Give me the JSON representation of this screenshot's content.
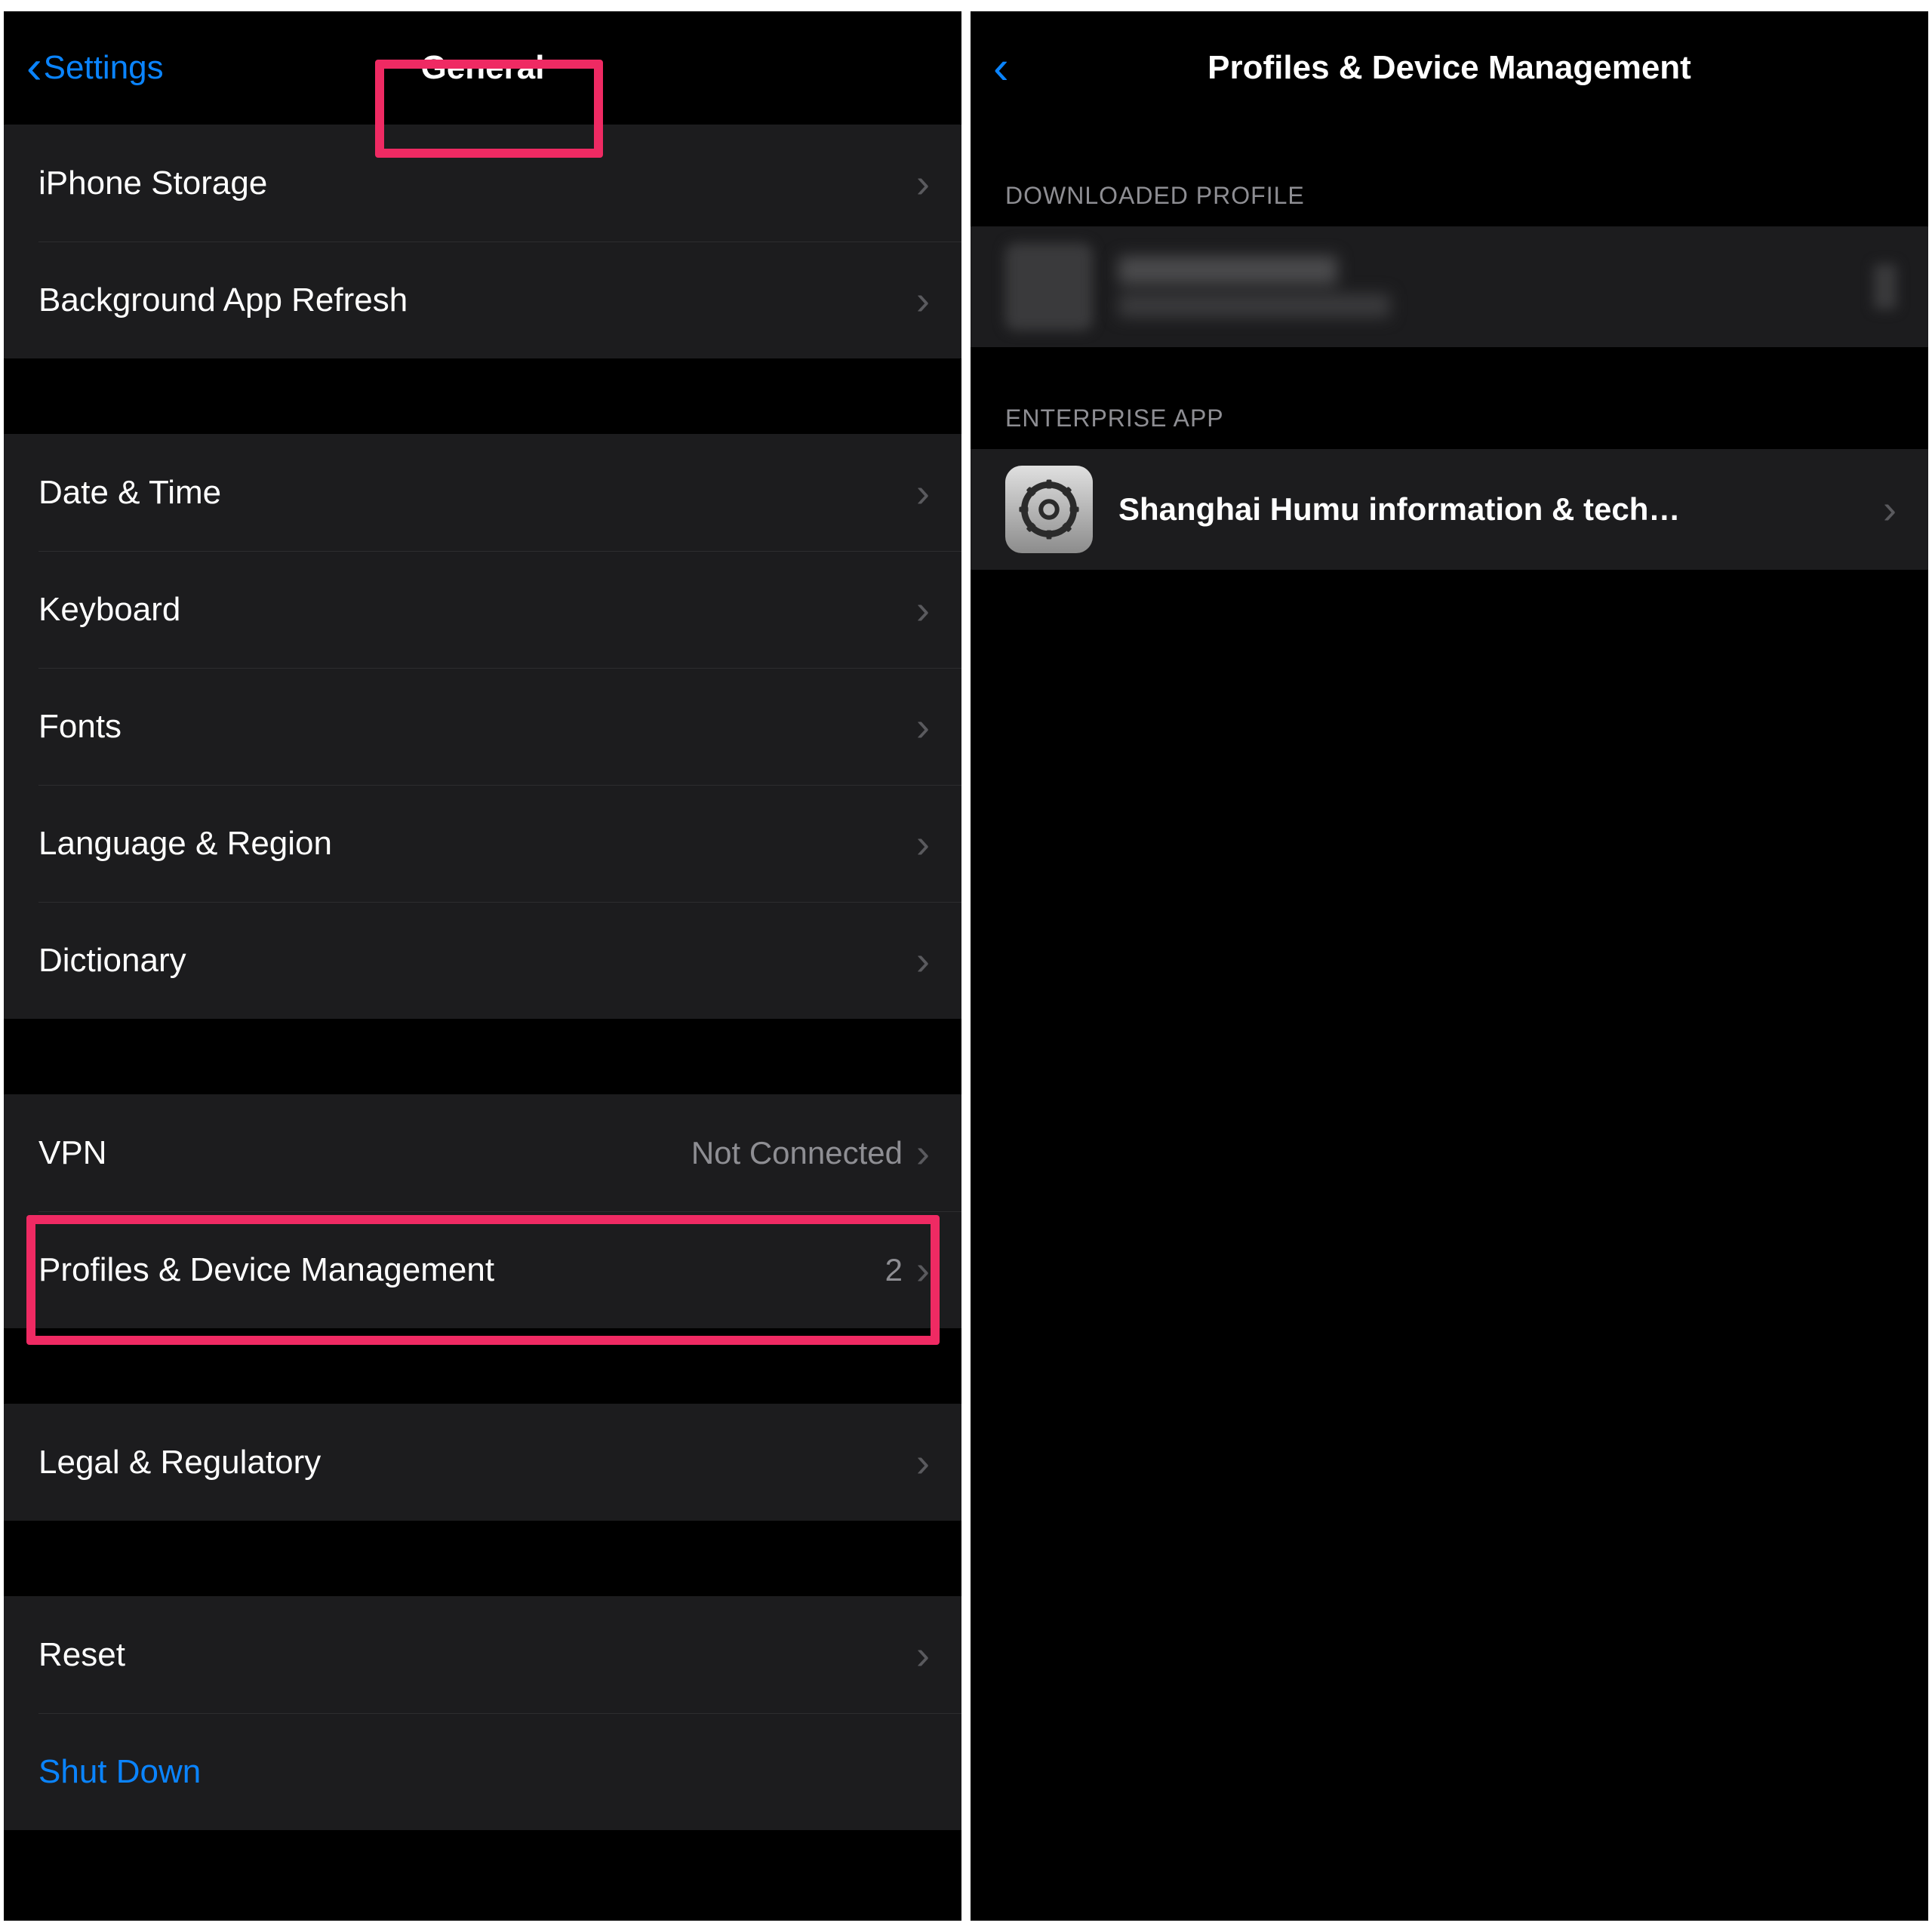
{
  "left": {
    "nav": {
      "back_label": "Settings",
      "title": "General"
    },
    "group1": [
      {
        "label": "iPhone Storage"
      },
      {
        "label": "Background App Refresh"
      }
    ],
    "group2": [
      {
        "label": "Date & Time"
      },
      {
        "label": "Keyboard"
      },
      {
        "label": "Fonts"
      },
      {
        "label": "Language & Region"
      },
      {
        "label": "Dictionary"
      }
    ],
    "group3": [
      {
        "label": "VPN",
        "detail": "Not Connected"
      },
      {
        "label": "Profiles & Device Management",
        "count": "2"
      }
    ],
    "group4": [
      {
        "label": "Legal & Regulatory"
      }
    ],
    "group5": [
      {
        "label": "Reset"
      },
      {
        "label": "Shut Down",
        "blue": true,
        "no_chev": true
      }
    ]
  },
  "right": {
    "nav": {
      "title": "Profiles & Device Management"
    },
    "section_profile": "DOWNLOADED PROFILE",
    "profile_row": {
      "title": "",
      "subtitle": ""
    },
    "section_enterprise": "ENTERPRISE APP",
    "enterprise_row": {
      "label": "Shanghai Humu information & tech…"
    }
  },
  "colors": {
    "accent": "#0a84ff",
    "highlight": "#ef2a63"
  }
}
